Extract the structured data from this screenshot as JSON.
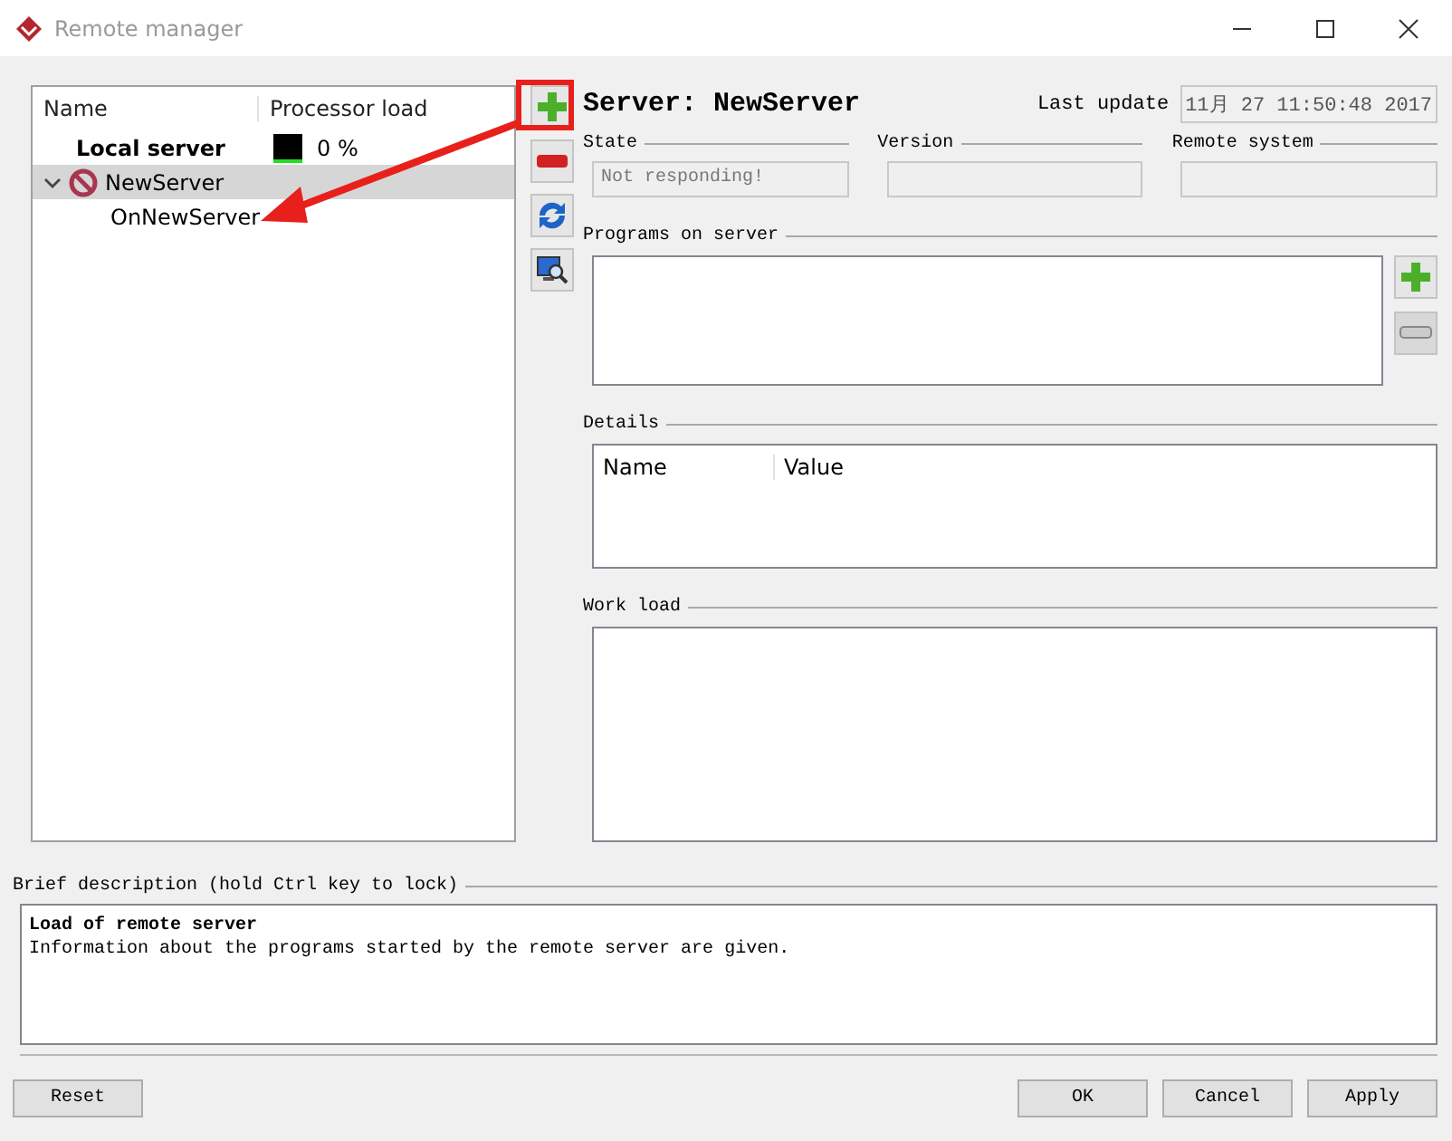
{
  "window": {
    "title": "Remote manager"
  },
  "tree": {
    "columns": [
      "Name",
      "Processor load"
    ],
    "rows": [
      {
        "name": "Local server",
        "kind": "local",
        "load": "0 %",
        "selected": false
      },
      {
        "name": "NewServer",
        "kind": "server",
        "expanded": true,
        "selected": true,
        "children": [
          {
            "name": "OnNewServer",
            "selected": false
          }
        ]
      }
    ]
  },
  "server": {
    "title": "Server: NewServer",
    "last_update_label": "Last update",
    "last_update": "11月 27 11:50:48 2017",
    "fields": [
      {
        "label": "State",
        "value": "Not responding!",
        "disabled": true
      },
      {
        "label": "Version",
        "disabled": true
      },
      {
        "label": "Remote system",
        "disabled": true
      }
    ]
  },
  "programs": {
    "label": "Programs on server"
  },
  "details": {
    "label": "Details",
    "columns": [
      "Name",
      "Value"
    ]
  },
  "work_load": {
    "label": "Work load"
  },
  "brief": {
    "label": "Brief description (hold Ctrl key to lock)",
    "title": "Load of remote server",
    "text": "Information about the programs started by the remote server are given."
  },
  "buttons": {
    "left": [
      "Reset"
    ],
    "right": [
      "OK",
      "Cancel",
      "Apply"
    ]
  }
}
